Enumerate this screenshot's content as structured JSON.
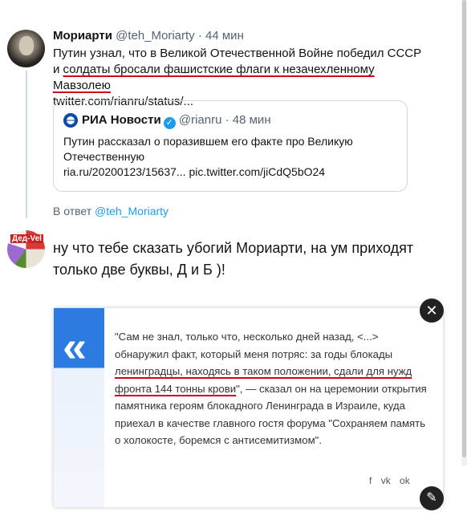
{
  "tweet": {
    "author_name": "Мориарти",
    "handle": "@teh_Moriarty",
    "time": "· 44 мин",
    "text_plain": "Путин узнал, что в Великой Отечественной Войне победил СССР и ",
    "text_underlined": "солдаты бросали фашистские флаги к незачехленному Мавзолею",
    "link": "twitter.com/rianru/status/..."
  },
  "quote": {
    "author_name": "РИА Новости",
    "handle": "@rianru",
    "time": "· 48 мин",
    "text": "Путин рассказал о поразившем его факте про Великую Отечественную",
    "links": "ria.ru/20200123/15637... pic.twitter.com/jiCdQ5bO24"
  },
  "reply_to": {
    "prefix": "В ответ",
    "handle": "@teh_Moriarty"
  },
  "reply": {
    "avatar_tag": "Дед-Vel",
    "text": "ну что тебе сказать убогий  Мориарти, на ум приходят только две буквы, Д и Б )!"
  },
  "card": {
    "text_before": "\"Сам не знал, только что, несколько дней назад, <...> обнаружил факт, который меня потряс: за годы блокады ",
    "text_marked": "ленинградцы, находясь в таком положении, сдали для нужд фронта 144 тонны крови",
    "text_after": "\", — сказал он на церемонии открытия памятника героям блокадного Ленинграда в Израиле, куда приехал в качестве главного гостя форума \"Сохраняем память о холокосте, боремся с антисемитизмом\".",
    "close_glyph": "✕",
    "edit_glyph": "✎",
    "share_icons": [
      "f",
      "vk",
      "ok"
    ]
  }
}
